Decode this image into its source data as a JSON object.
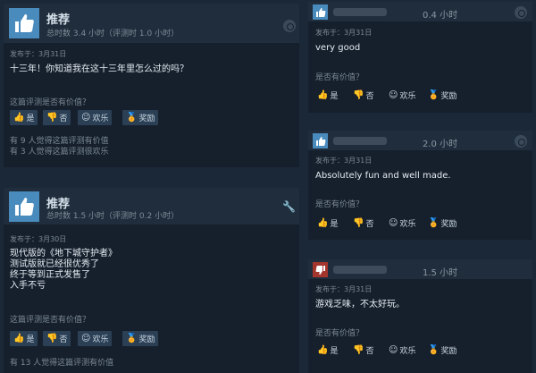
{
  "icons": {
    "thumbs_up": "thumbs-up-icon",
    "thumbs_down": "thumbs-down-icon",
    "smile": "smile-icon",
    "award": "award-icon",
    "steam": "steam-icon",
    "wrench": "wrench-icon"
  },
  "colors": {
    "positive": "#4a8bbd",
    "negative": "#a3352d",
    "award": "#e1b12c"
  },
  "labels": {
    "helpful_q": "这篇评测是否有价值？",
    "helpful_q_short": "是否有价值？",
    "yes": "是",
    "no": "否",
    "funny": "欢乐",
    "award": "奖励"
  },
  "left_reviews": [
    {
      "recommendation": "推荐",
      "hours": "总时数 3.4 小时（评测时 1.0 小时）",
      "posted": "发布于：3月31日",
      "text": "十三年！你知道我在这十三年里怎么过的吗？",
      "votes": [
        "有 9 人觉得这篇评测有价值",
        "有 3 人觉得这篇评测很欢乐"
      ]
    },
    {
      "recommendation": "推荐",
      "hours": "总时数 1.5 小时（评测时 0.2 小时）",
      "posted": "发布于：3月30日",
      "text": "现代版的《地下城守护者》\n测试版就已经很优秀了\n终于等到正式发售了\n入手不亏",
      "votes": [
        "有 13 人觉得这篇评测有价值"
      ]
    }
  ],
  "right_reviews": [
    {
      "hours": "0.4 小时",
      "posted": "发布于：3月31日",
      "text": "very good",
      "sentiment": "positive"
    },
    {
      "hours": "2.0 小时",
      "posted": "发布于：3月31日",
      "text": "Absolutely fun and well made.",
      "sentiment": "positive"
    },
    {
      "hours": "1.5 小时",
      "posted": "发布于：3月31日",
      "text": "游戏乏味，不太好玩。",
      "sentiment": "negative"
    }
  ]
}
